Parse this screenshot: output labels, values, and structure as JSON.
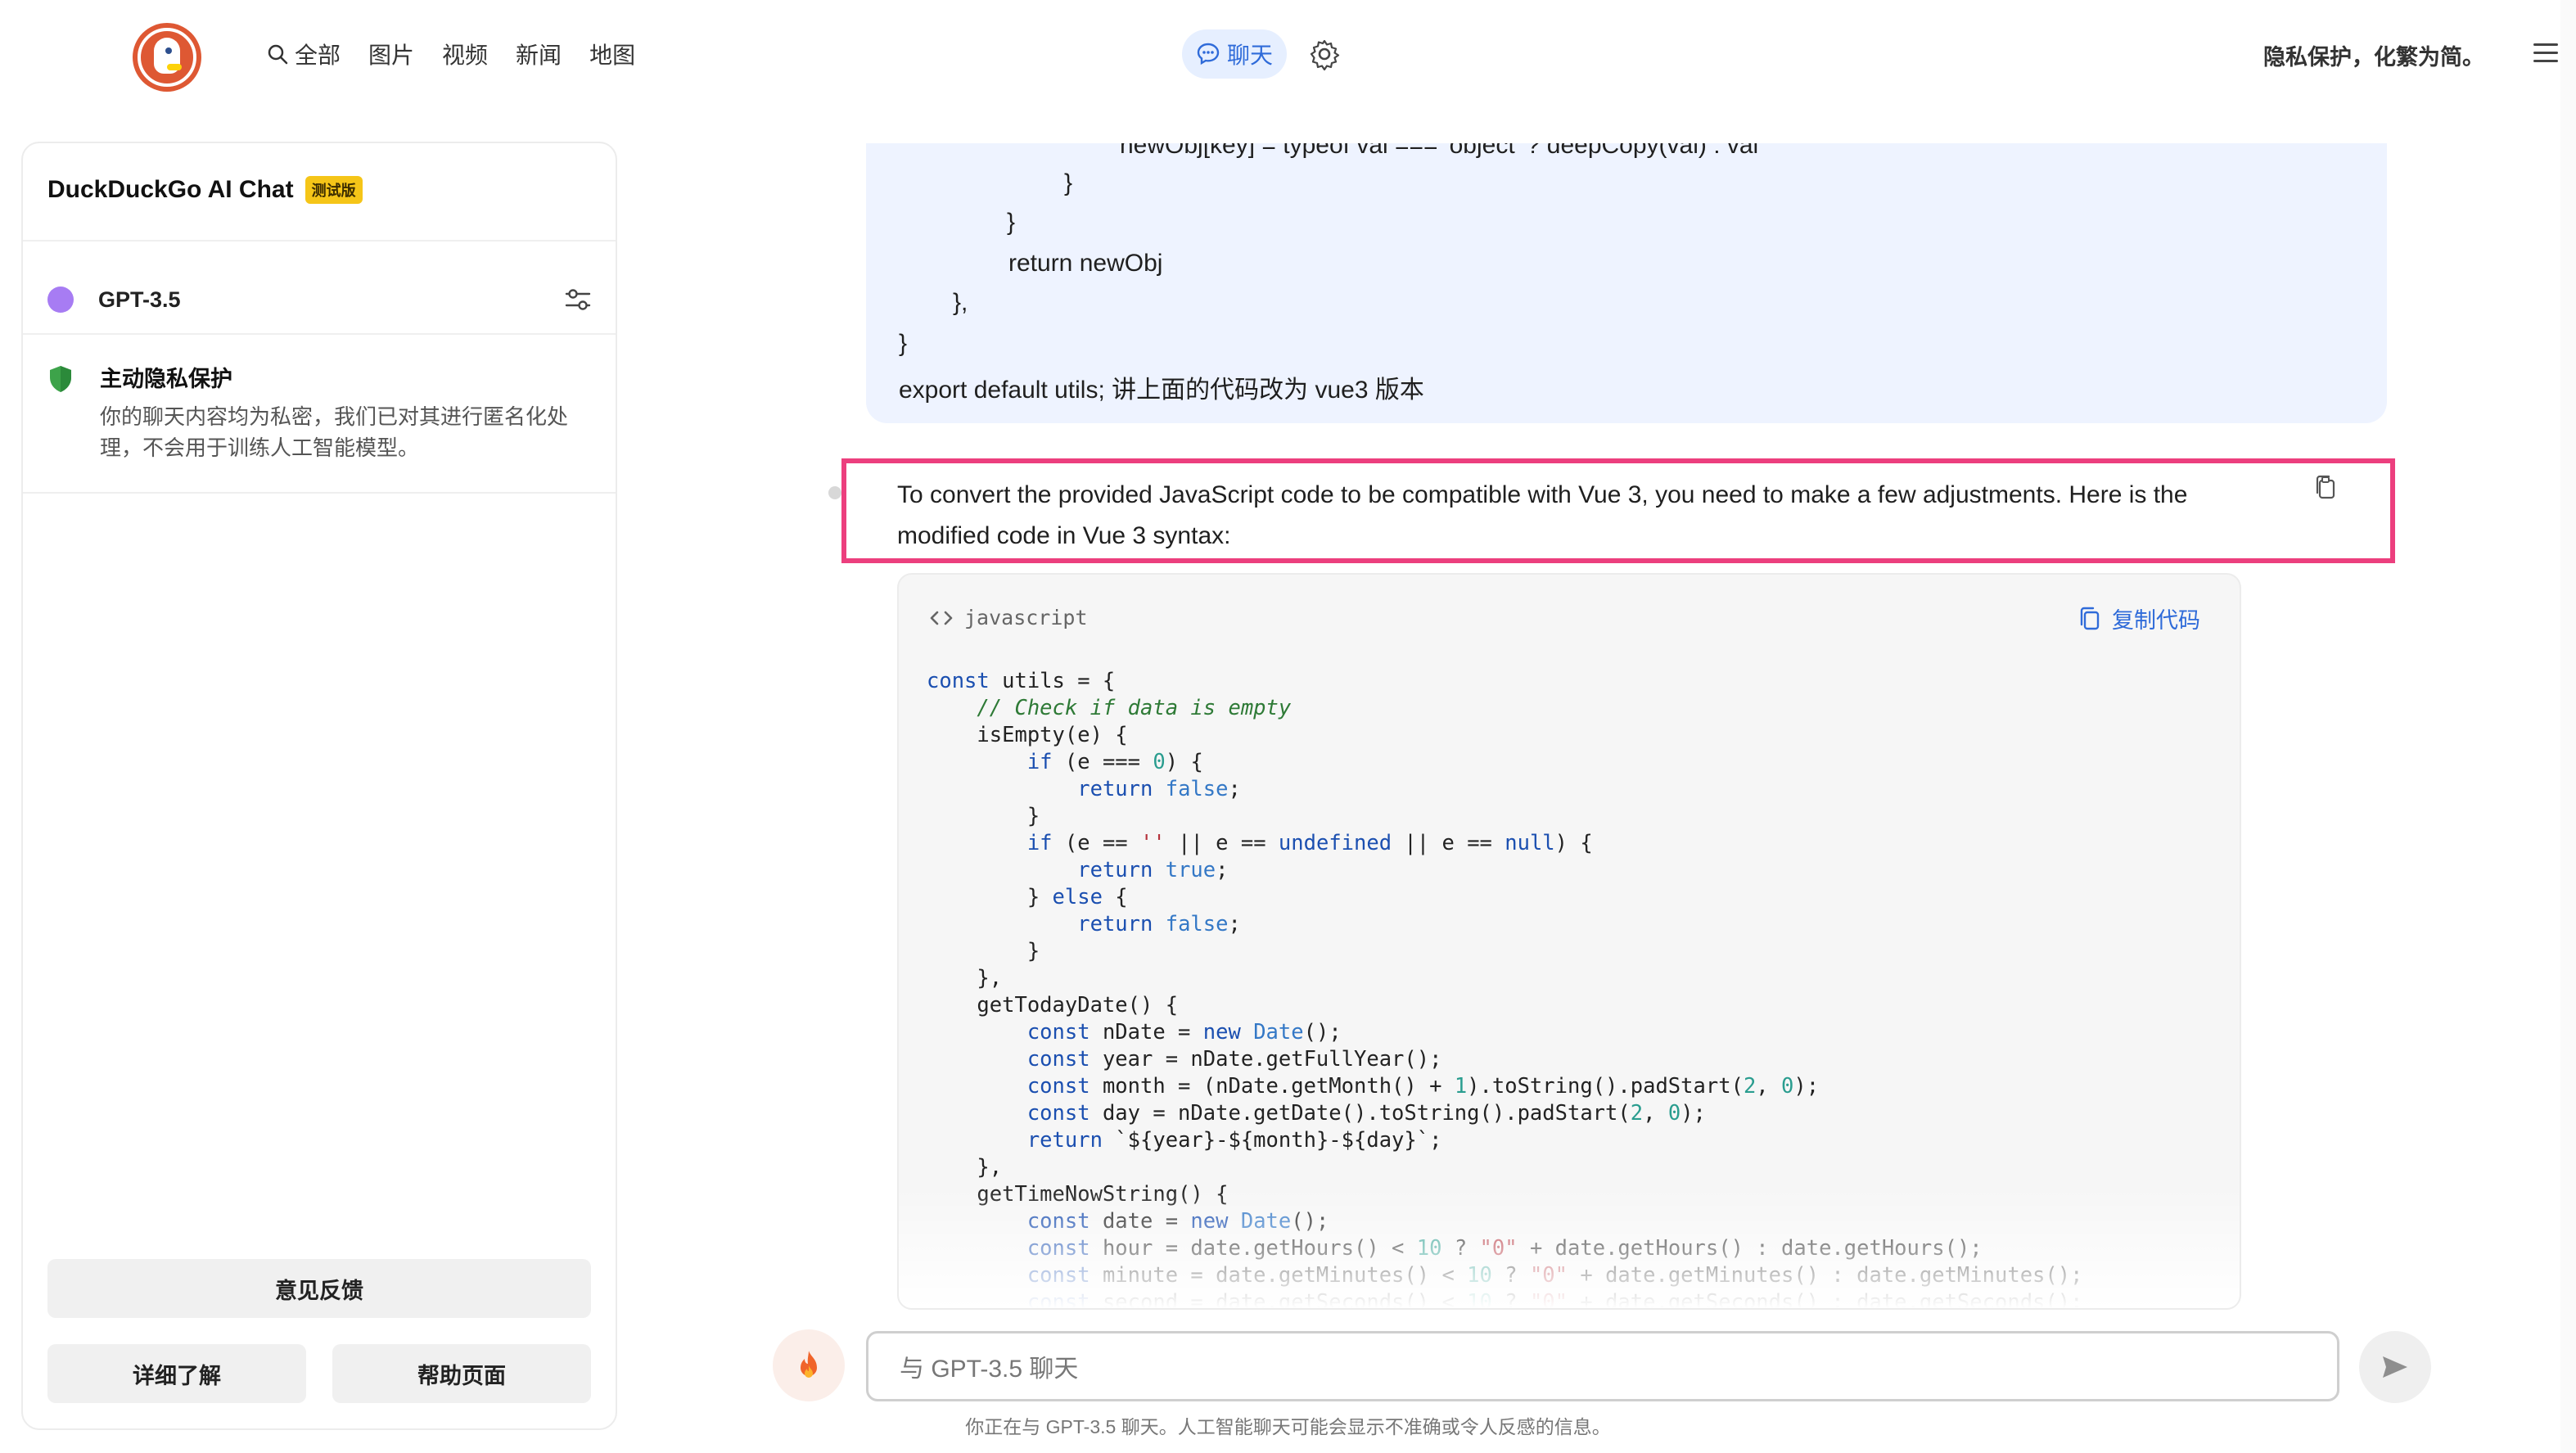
{
  "header": {
    "nav": [
      {
        "label": "全部",
        "icon": "search-icon"
      },
      {
        "label": "图片"
      },
      {
        "label": "视频"
      },
      {
        "label": "新闻"
      },
      {
        "label": "地图"
      }
    ],
    "chat_tab": "聊天",
    "privacy_slogan": "隐私保护，化繁为简。"
  },
  "sidebar": {
    "title": "DuckDuckGo AI Chat",
    "beta_badge": "测试版",
    "model": "GPT-3.5",
    "privacy_title": "主动隐私保护",
    "privacy_text": "你的聊天内容均为私密，我们已对其进行匿名化处理，不会用于训练人工智能模型。",
    "feedback_btn": "意见反馈",
    "learn_more_btn": "详细了解",
    "help_btn": "帮助页面"
  },
  "user_message": {
    "lines": [
      "newObj[key] = typeof val === 'object' ? deepCopy(val) : val",
      "}",
      "}",
      "return newObj",
      "},",
      "}",
      "export default utils; 讲上面的代码改为 vue3 版本"
    ]
  },
  "assistant_message": {
    "text": "To convert the provided JavaScript code to be compatible with Vue 3, you need to make a few adjustments. Here is the modified code in Vue 3 syntax:"
  },
  "code_block": {
    "language": "javascript",
    "copy_label": "复制代码"
  },
  "composer": {
    "placeholder": "与 GPT-3.5 聊天",
    "disclaimer": "你正在与 GPT-3.5 聊天。人工智能聊天可能会显示不准确或令人反感的信息。"
  },
  "colors": {
    "accent_blue": "#2f6bd9",
    "highlight_pink": "#ec3f7e",
    "user_bubble": "#eef3ff",
    "model_dot": "#a77cf3",
    "brand_orange": "#de5833"
  }
}
